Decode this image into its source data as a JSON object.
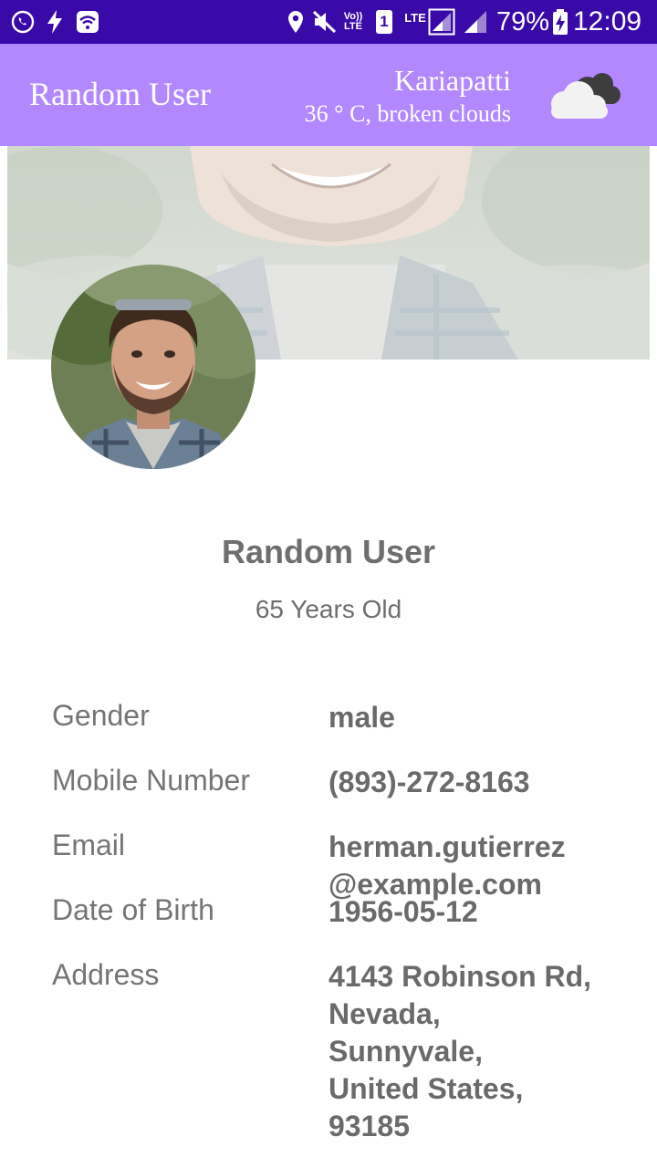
{
  "status_bar": {
    "battery_percent": "79%",
    "time": "12:09",
    "network_volte_top": "Vo))",
    "network_volte_bottom": "LTE",
    "sim_slot": "1",
    "lte_label": "LTE",
    "icons": [
      "whatsapp-icon",
      "flash-icon",
      "wifi-icon",
      "location-icon",
      "mute-icon",
      "volte-icon",
      "sim-icon",
      "signal-icon",
      "battery-charging-icon"
    ]
  },
  "app_bar": {
    "title": "Random User",
    "weather": {
      "city": "Kariapatti",
      "description": "36 ° C, broken clouds",
      "icon": "broken-clouds-icon"
    }
  },
  "profile": {
    "name": "Random User",
    "age": "65 Years Old"
  },
  "details": {
    "gender_label": "Gender",
    "gender_value": "male",
    "mobile_label": "Mobile Number",
    "mobile_value": "(893)-272-8163",
    "email_label": "Email",
    "email_line1": "herman.gutierrez",
    "email_line2": "@example.com",
    "dob_label": "Date of Birth",
    "dob_value": "1956-05-12",
    "address_label": "Address",
    "address_line1": "4143 Robinson Rd,",
    "address_line2": "Nevada,",
    "address_line3": "Sunnyvale,",
    "address_line4": "United States,",
    "address_line5": "93185"
  },
  "colors": {
    "status_bar": "#3a0aa8",
    "app_bar": "#b388ff",
    "label_text": "#757575",
    "value_text": "#6a6a6a"
  }
}
